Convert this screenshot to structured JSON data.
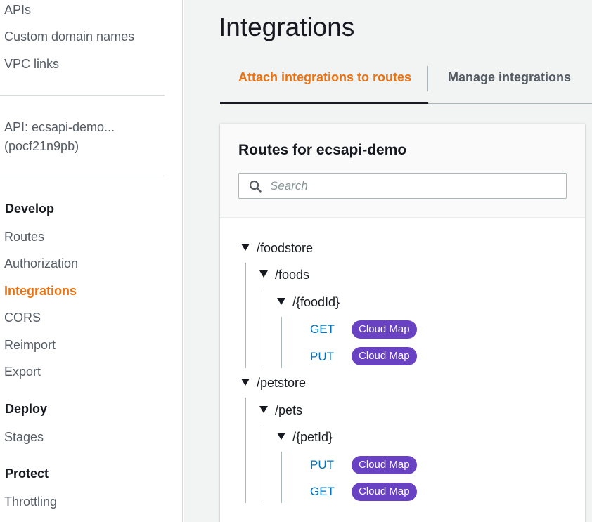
{
  "sidebar": {
    "top_links": [
      "APIs",
      "Custom domain names",
      "VPC links"
    ],
    "api_name": "API: ecsapi-demo...",
    "api_id": "(pocf21n9pb)",
    "sections": {
      "develop": "Develop",
      "deploy": "Deploy",
      "protect": "Protect"
    },
    "develop_items": [
      "Routes",
      "Authorization",
      "Integrations",
      "CORS",
      "Reimport",
      "Export"
    ],
    "deploy_items": [
      "Stages"
    ],
    "protect_items": [
      "Throttling"
    ],
    "active_item": "Integrations"
  },
  "main": {
    "title": "Integrations",
    "tabs": [
      {
        "label": "Attach integrations to routes",
        "active": true
      },
      {
        "label": "Manage integrations",
        "active": false
      }
    ]
  },
  "panel": {
    "title": "Routes for ecsapi-demo",
    "search_placeholder": "Search",
    "search_value": ""
  },
  "routes": {
    "foodstore": "/foodstore",
    "foods": "/foods",
    "foodId": "/{foodId}",
    "food_methods": [
      {
        "method": "GET",
        "badge": "Cloud Map"
      },
      {
        "method": "PUT",
        "badge": "Cloud Map"
      }
    ],
    "petstore": "/petstore",
    "pets": "/pets",
    "petId": "/{petId}",
    "pet_methods": [
      {
        "method": "PUT",
        "badge": "Cloud Map"
      },
      {
        "method": "GET",
        "badge": "Cloud Map"
      }
    ]
  },
  "colors": {
    "accent": "#ec7211",
    "link": "#0073bb",
    "badge": "#6842c2"
  },
  "icons": [
    "search-icon",
    "caret-down-icon"
  ]
}
